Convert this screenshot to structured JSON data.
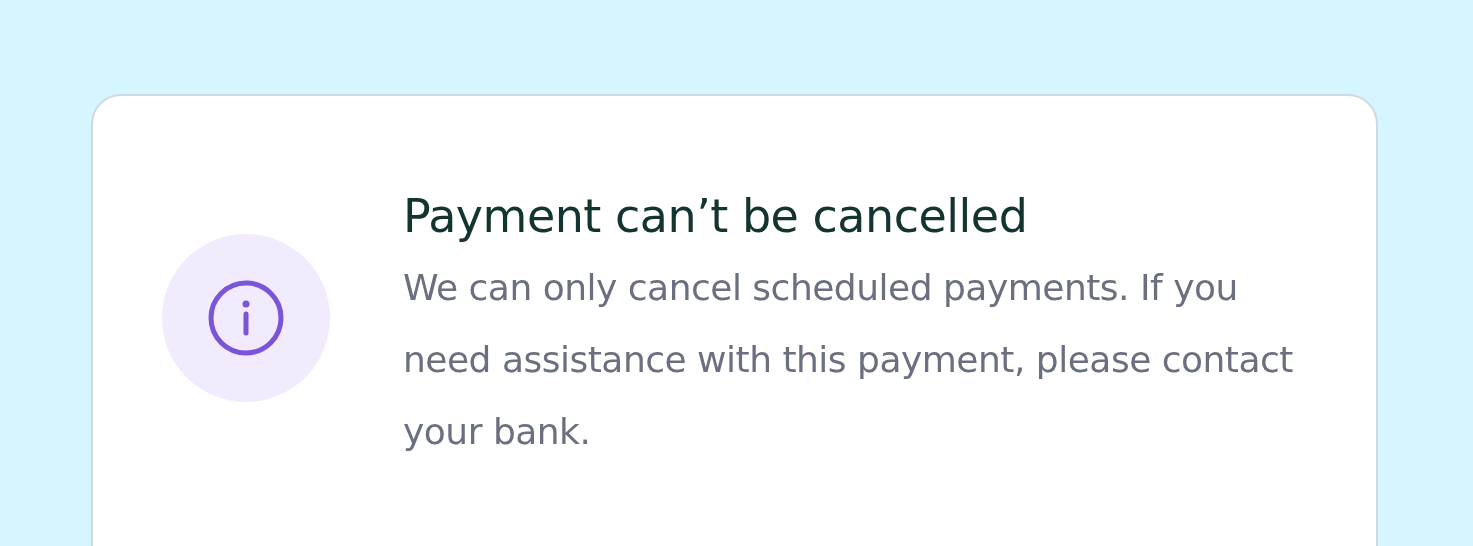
{
  "notice": {
    "title": "Payment can’t be cancelled",
    "message": "We can only cancel scheduled payments. If you need assistance with this payment, please contact your bank."
  }
}
